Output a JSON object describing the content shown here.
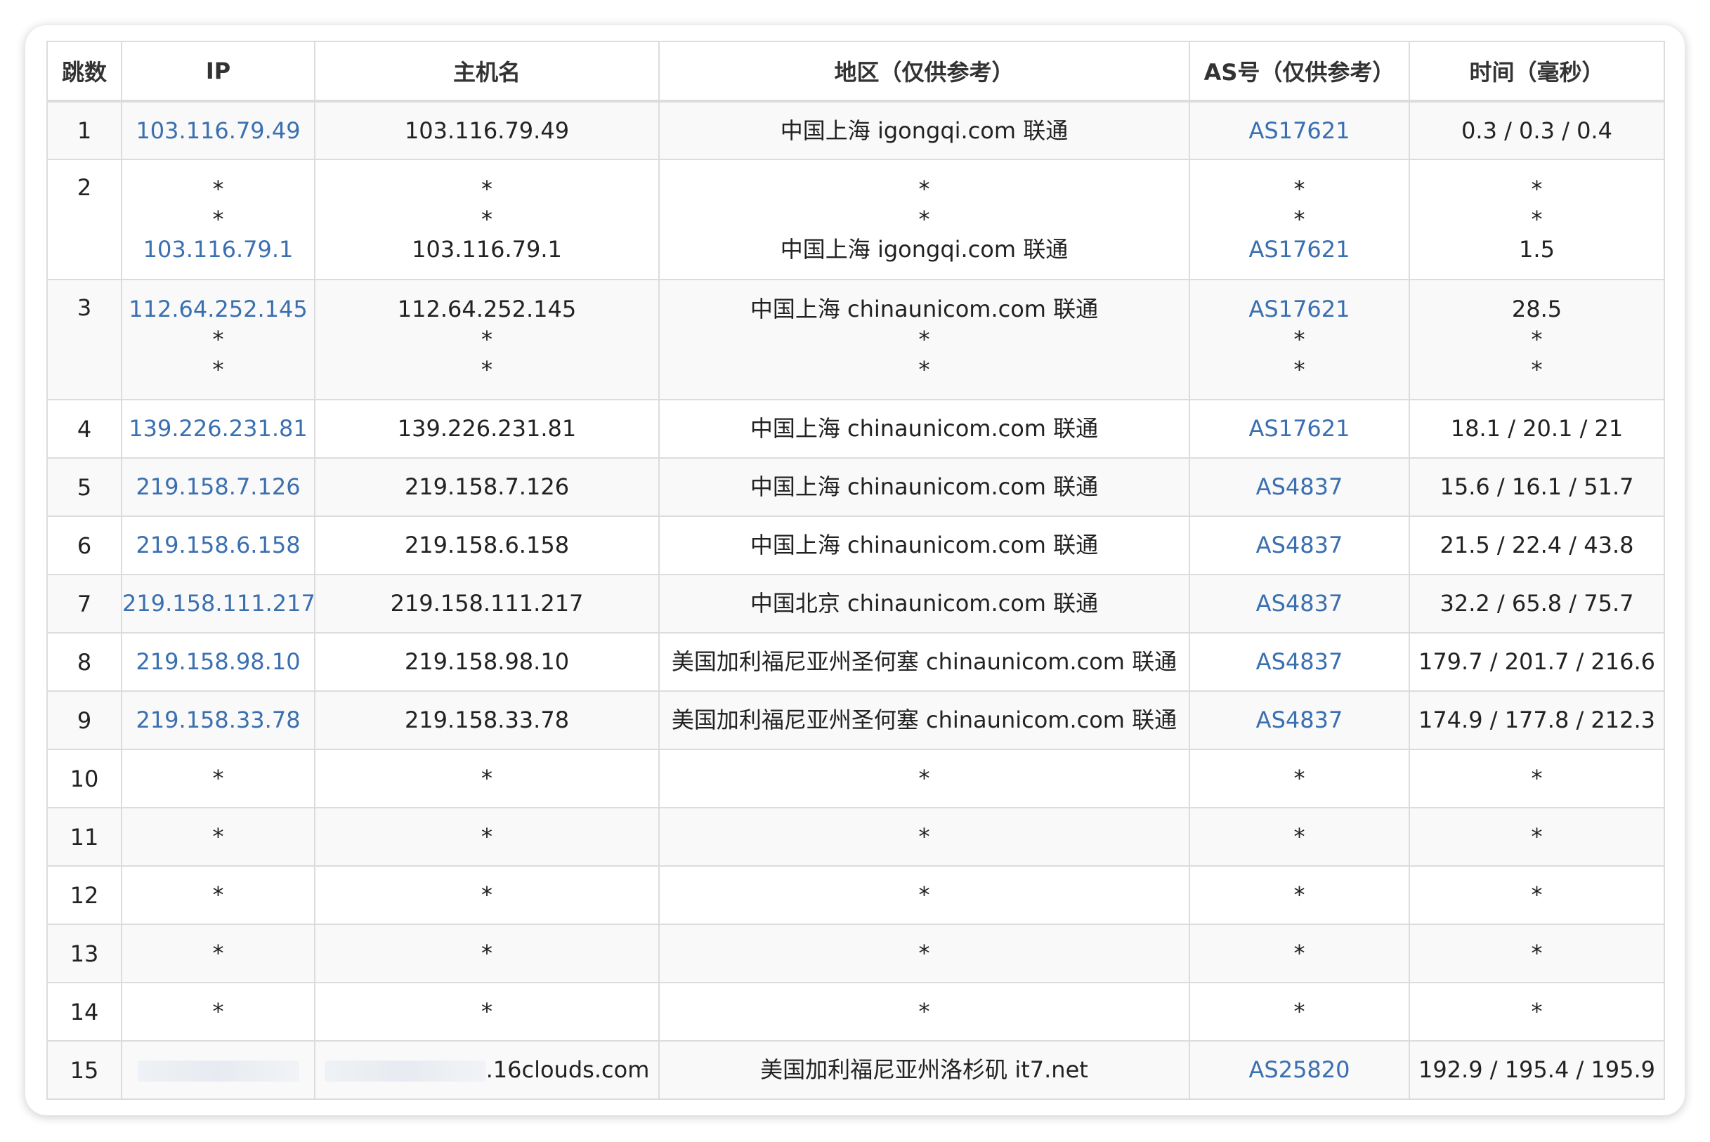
{
  "headers": [
    "跳数",
    "IP",
    "主机名",
    "地区（仅供参考）",
    "AS号（仅供参考）",
    "时间（毫秒）"
  ],
  "rows": [
    {
      "hop": "1",
      "ip": [
        "103.116.79.49"
      ],
      "host": [
        "103.116.79.49"
      ],
      "region": [
        "中国上海 igongqi.com 联通"
      ],
      "as": [
        "AS17621"
      ],
      "time": [
        "0.3 / 0.3 / 0.4"
      ]
    },
    {
      "hop": "2",
      "ip": [
        "*",
        "*",
        "103.116.79.1"
      ],
      "host": [
        "*",
        "*",
        "103.116.79.1"
      ],
      "region": [
        "*",
        "*",
        "中国上海 igongqi.com 联通"
      ],
      "as": [
        "*",
        "*",
        "AS17621"
      ],
      "time": [
        "*",
        "*",
        "1.5"
      ]
    },
    {
      "hop": "3",
      "ip": [
        "112.64.252.145",
        "*",
        "*"
      ],
      "host": [
        "112.64.252.145",
        "*",
        "*"
      ],
      "region": [
        "中国上海 chinaunicom.com 联通",
        "*",
        "*"
      ],
      "as": [
        "AS17621",
        "*",
        "*"
      ],
      "time": [
        "28.5",
        "*",
        "*"
      ]
    },
    {
      "hop": "4",
      "ip": [
        "139.226.231.81"
      ],
      "host": [
        "139.226.231.81"
      ],
      "region": [
        "中国上海 chinaunicom.com 联通"
      ],
      "as": [
        "AS17621"
      ],
      "time": [
        "18.1 / 20.1 / 21"
      ]
    },
    {
      "hop": "5",
      "ip": [
        "219.158.7.126"
      ],
      "host": [
        "219.158.7.126"
      ],
      "region": [
        "中国上海 chinaunicom.com 联通"
      ],
      "as": [
        "AS4837"
      ],
      "time": [
        "15.6 / 16.1 / 51.7"
      ]
    },
    {
      "hop": "6",
      "ip": [
        "219.158.6.158"
      ],
      "host": [
        "219.158.6.158"
      ],
      "region": [
        "中国上海 chinaunicom.com 联通"
      ],
      "as": [
        "AS4837"
      ],
      "time": [
        "21.5 / 22.4 / 43.8"
      ]
    },
    {
      "hop": "7",
      "ip": [
        "219.158.111.217"
      ],
      "host": [
        "219.158.111.217"
      ],
      "region": [
        "中国北京 chinaunicom.com 联通"
      ],
      "as": [
        "AS4837"
      ],
      "time": [
        "32.2 / 65.8 / 75.7"
      ]
    },
    {
      "hop": "8",
      "ip": [
        "219.158.98.10"
      ],
      "host": [
        "219.158.98.10"
      ],
      "region": [
        "美国加利福尼亚州圣何塞 chinaunicom.com 联通"
      ],
      "as": [
        "AS4837"
      ],
      "time": [
        "179.7 / 201.7 / 216.6"
      ]
    },
    {
      "hop": "9",
      "ip": [
        "219.158.33.78"
      ],
      "host": [
        "219.158.33.78"
      ],
      "region": [
        "美国加利福尼亚州圣何塞 chinaunicom.com 联通"
      ],
      "as": [
        "AS4837"
      ],
      "time": [
        "174.9 / 177.8 / 212.3"
      ]
    },
    {
      "hop": "10",
      "ip": [
        "*"
      ],
      "host": [
        "*"
      ],
      "region": [
        "*"
      ],
      "as": [
        "*"
      ],
      "time": [
        "*"
      ]
    },
    {
      "hop": "11",
      "ip": [
        "*"
      ],
      "host": [
        "*"
      ],
      "region": [
        "*"
      ],
      "as": [
        "*"
      ],
      "time": [
        "*"
      ]
    },
    {
      "hop": "12",
      "ip": [
        "*"
      ],
      "host": [
        "*"
      ],
      "region": [
        "*"
      ],
      "as": [
        "*"
      ],
      "time": [
        "*"
      ]
    },
    {
      "hop": "13",
      "ip": [
        "*"
      ],
      "host": [
        "*"
      ],
      "region": [
        "*"
      ],
      "as": [
        "*"
      ],
      "time": [
        "*"
      ]
    },
    {
      "hop": "14",
      "ip": [
        "*"
      ],
      "host": [
        "*"
      ],
      "region": [
        "*"
      ],
      "as": [
        "*"
      ],
      "time": [
        "*"
      ]
    },
    {
      "hop": "15",
      "ip": [
        "REDACTED"
      ],
      "host": [
        ".16clouds.com"
      ],
      "region": [
        "美国加利福尼亚州洛杉矶 it7.net"
      ],
      "as": [
        "AS25820"
      ],
      "time": [
        "192.9 / 195.4 / 195.9"
      ]
    }
  ],
  "colors": {
    "link": "#3a6fb0",
    "border": "#dcdcdc",
    "stripe": "#f9f9f9"
  }
}
